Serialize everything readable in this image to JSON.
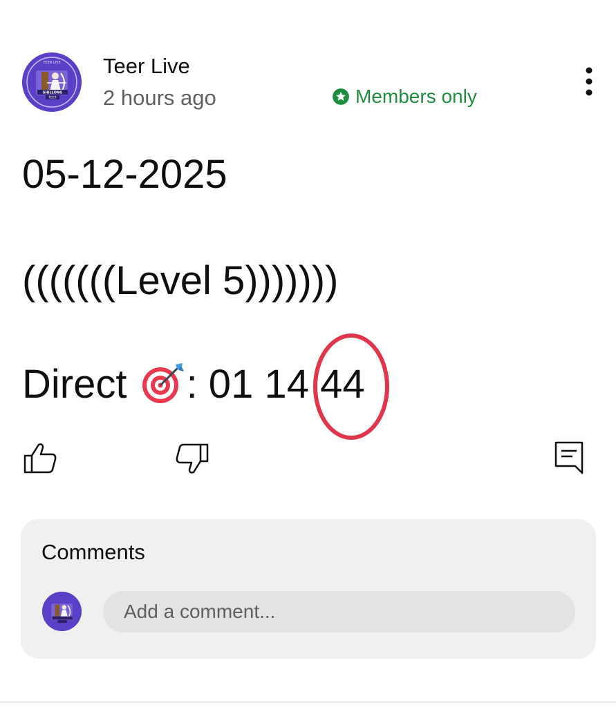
{
  "post": {
    "channel_name": "Teer Live",
    "time_ago": "2 hours ago",
    "visibility_label": "Members only",
    "avatar_text": {
      "top": "TEER LIVE",
      "middle": "SHILLONG",
      "bottom": "TEER"
    },
    "lines": {
      "date": "05-12-2025",
      "level": "(((((((Level 5)))))))",
      "direct_label": "Direct ",
      "direct_numbers": ": 01 14 44",
      "direct_emoji": "direct-hit-target-icon"
    },
    "actions": {
      "like": "thumbs-up-icon",
      "dislike": "thumbs-down-icon",
      "comment": "comment-icon"
    }
  },
  "comments": {
    "title": "Comments",
    "input_placeholder": "Add a comment..."
  },
  "colors": {
    "members_green": "#1e8e3e",
    "annotation_red": "#e0354a",
    "avatar_purple": "#5b3fc7",
    "card_bg": "#f0f0f0",
    "input_bg": "#e3e3e3",
    "muted_text": "#606060"
  }
}
